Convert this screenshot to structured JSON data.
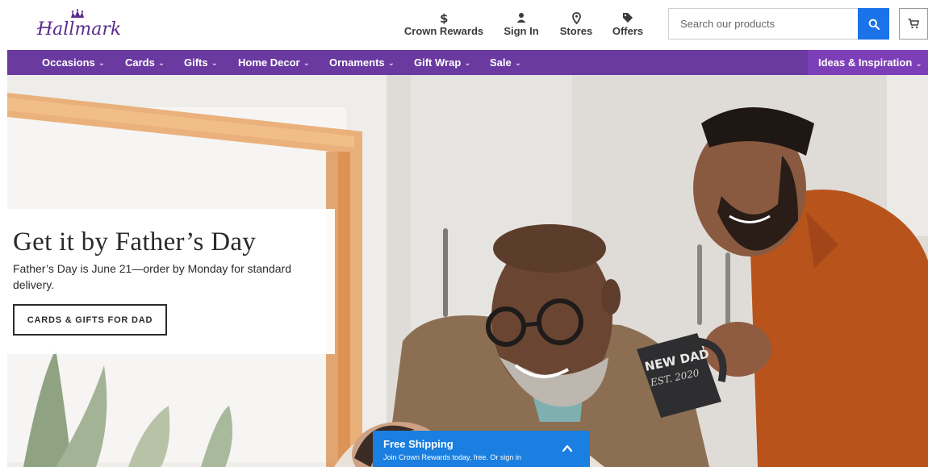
{
  "header": {
    "logo_text": "Hallmark",
    "utility": [
      {
        "label": "Crown Rewards",
        "icon": "dollar-icon"
      },
      {
        "label": "Sign In",
        "icon": "person-icon"
      },
      {
        "label": "Stores",
        "icon": "location-pin-icon"
      },
      {
        "label": "Offers",
        "icon": "tag-icon"
      }
    ],
    "search": {
      "placeholder": "Search our products",
      "value": ""
    },
    "cart_icon": "cart-icon"
  },
  "nav": {
    "items": [
      {
        "label": "Occasions"
      },
      {
        "label": "Cards"
      },
      {
        "label": "Gifts"
      },
      {
        "label": "Home Decor"
      },
      {
        "label": "Ornaments"
      },
      {
        "label": "Gift Wrap"
      },
      {
        "label": "Sale"
      }
    ],
    "ideas_label": "Ideas & Inspiration"
  },
  "hero": {
    "title": "Get it by Father’s Day",
    "text": "Father’s Day is June 21—order by Monday for standard delivery.",
    "cta_label": "CARDS & GIFTS FOR DAD",
    "mug_line1": "NEW DAD",
    "mug_line2": "EST. 2020"
  },
  "shipping": {
    "title": "Free Shipping",
    "subtitle": "Join Crown Rewards today, free. Or sign in"
  },
  "colors": {
    "nav_purple": "#6a3aa0",
    "nav_ideas_purple": "#7d3fb8",
    "search_blue": "#1a73e8",
    "shipping_blue": "#1a7fe0",
    "logo_purple": "#5a2d8c"
  }
}
